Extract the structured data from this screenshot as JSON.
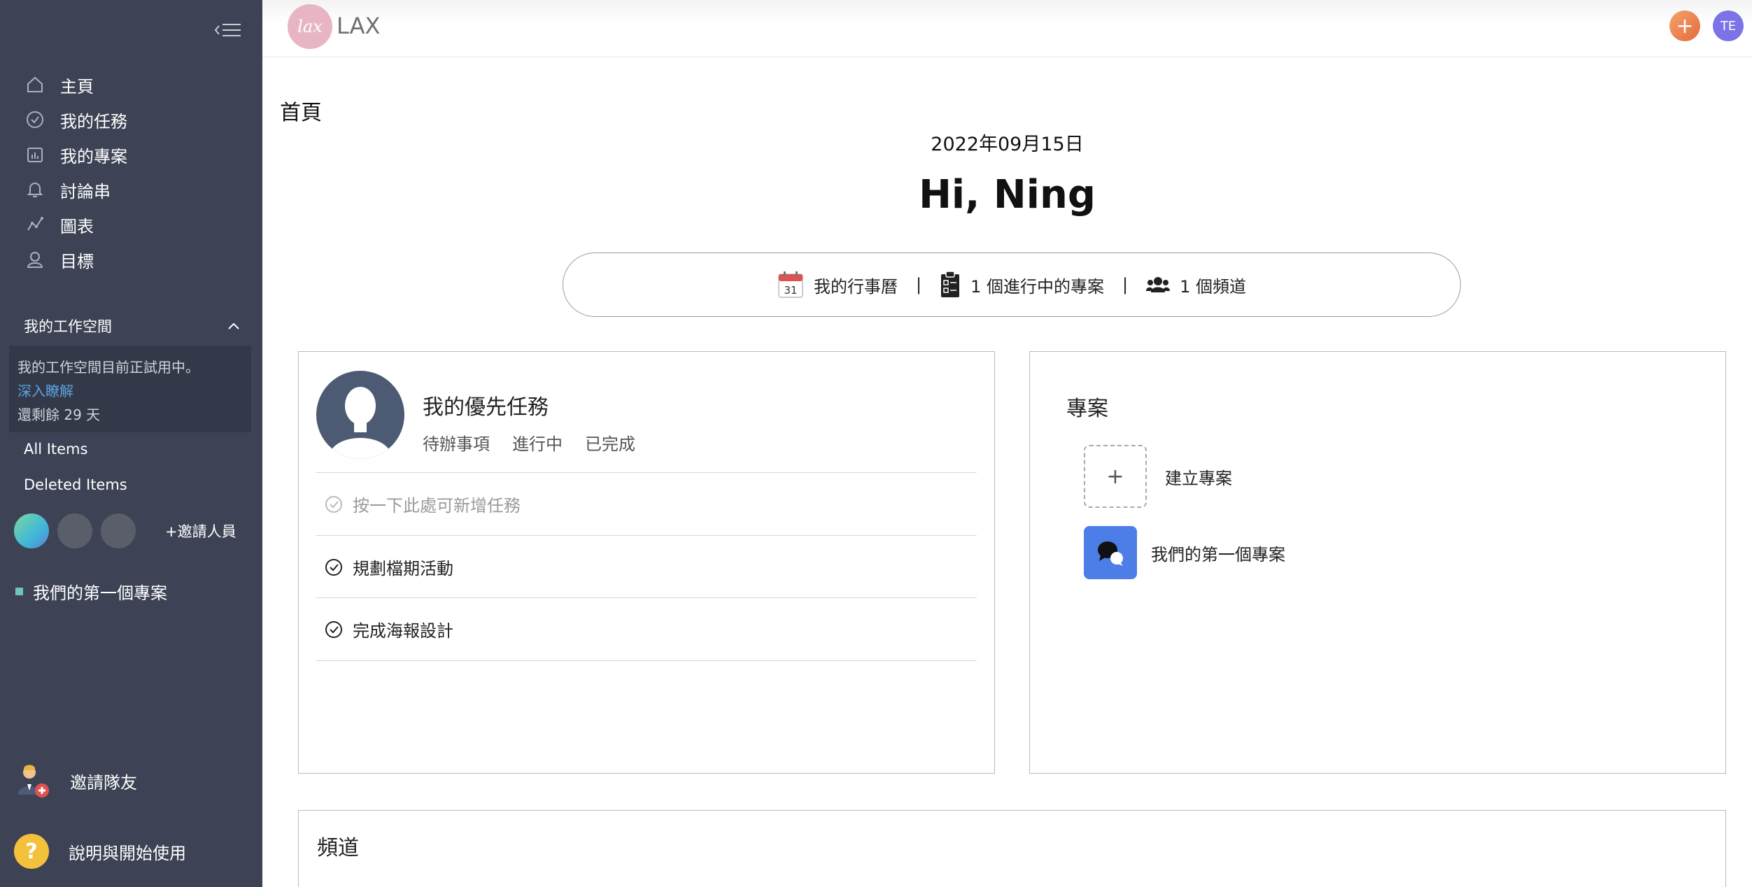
{
  "brand": {
    "name": "LAX",
    "logo_text": "lax"
  },
  "topbar": {
    "add_label": "+",
    "avatar_initials": "TE"
  },
  "sidebar": {
    "nav": [
      {
        "label": "主頁",
        "icon": "home-icon"
      },
      {
        "label": "我的任務",
        "icon": "check-circle-icon"
      },
      {
        "label": "我的專案",
        "icon": "project-icon"
      },
      {
        "label": "討論串",
        "icon": "bell-icon"
      },
      {
        "label": "圖表",
        "icon": "chart-icon"
      },
      {
        "label": "目標",
        "icon": "user-goal-icon"
      }
    ],
    "workspace_label": "我的工作空間",
    "trial": {
      "line1": "我的工作空間目前正試用中。",
      "link": "深入瞭解",
      "remaining": "還剩餘 29 天"
    },
    "all_items": "All Items",
    "deleted_items": "Deleted Items",
    "invite_people": "+邀請人員",
    "project": "我們的第一個專案",
    "invite_team": "邀請隊友",
    "help": "說明與開始使用",
    "help_icon_text": "?"
  },
  "main": {
    "page_title": "首頁",
    "date": "2022年09月15日",
    "greeting": "Hi, Ning",
    "summary": {
      "calendar_day": "31",
      "calendar": "我的行事曆",
      "sep": "|",
      "projects": "1 個進行中的專案",
      "channels": "1 個頻道"
    },
    "tasks": {
      "title": "我的優先任務",
      "tabs": [
        "待辦事項",
        "進行中",
        "已完成"
      ],
      "add_placeholder": "按一下此處可新增任務",
      "items": [
        "規劃檔期活動",
        "完成海報設計"
      ]
    },
    "projects": {
      "title": "專案",
      "create_icon": "+",
      "create": "建立專案",
      "item": "我們的第一個專案"
    },
    "channels": {
      "title": "頻道"
    }
  },
  "colors": {
    "sidebar_bg": "#3d4354",
    "trial_bg": "#333948",
    "link": "#5aa3e0",
    "project_blue": "#4d7de6",
    "avatar_purple": "#7b73e6",
    "add_orange": "#e46a3d"
  }
}
